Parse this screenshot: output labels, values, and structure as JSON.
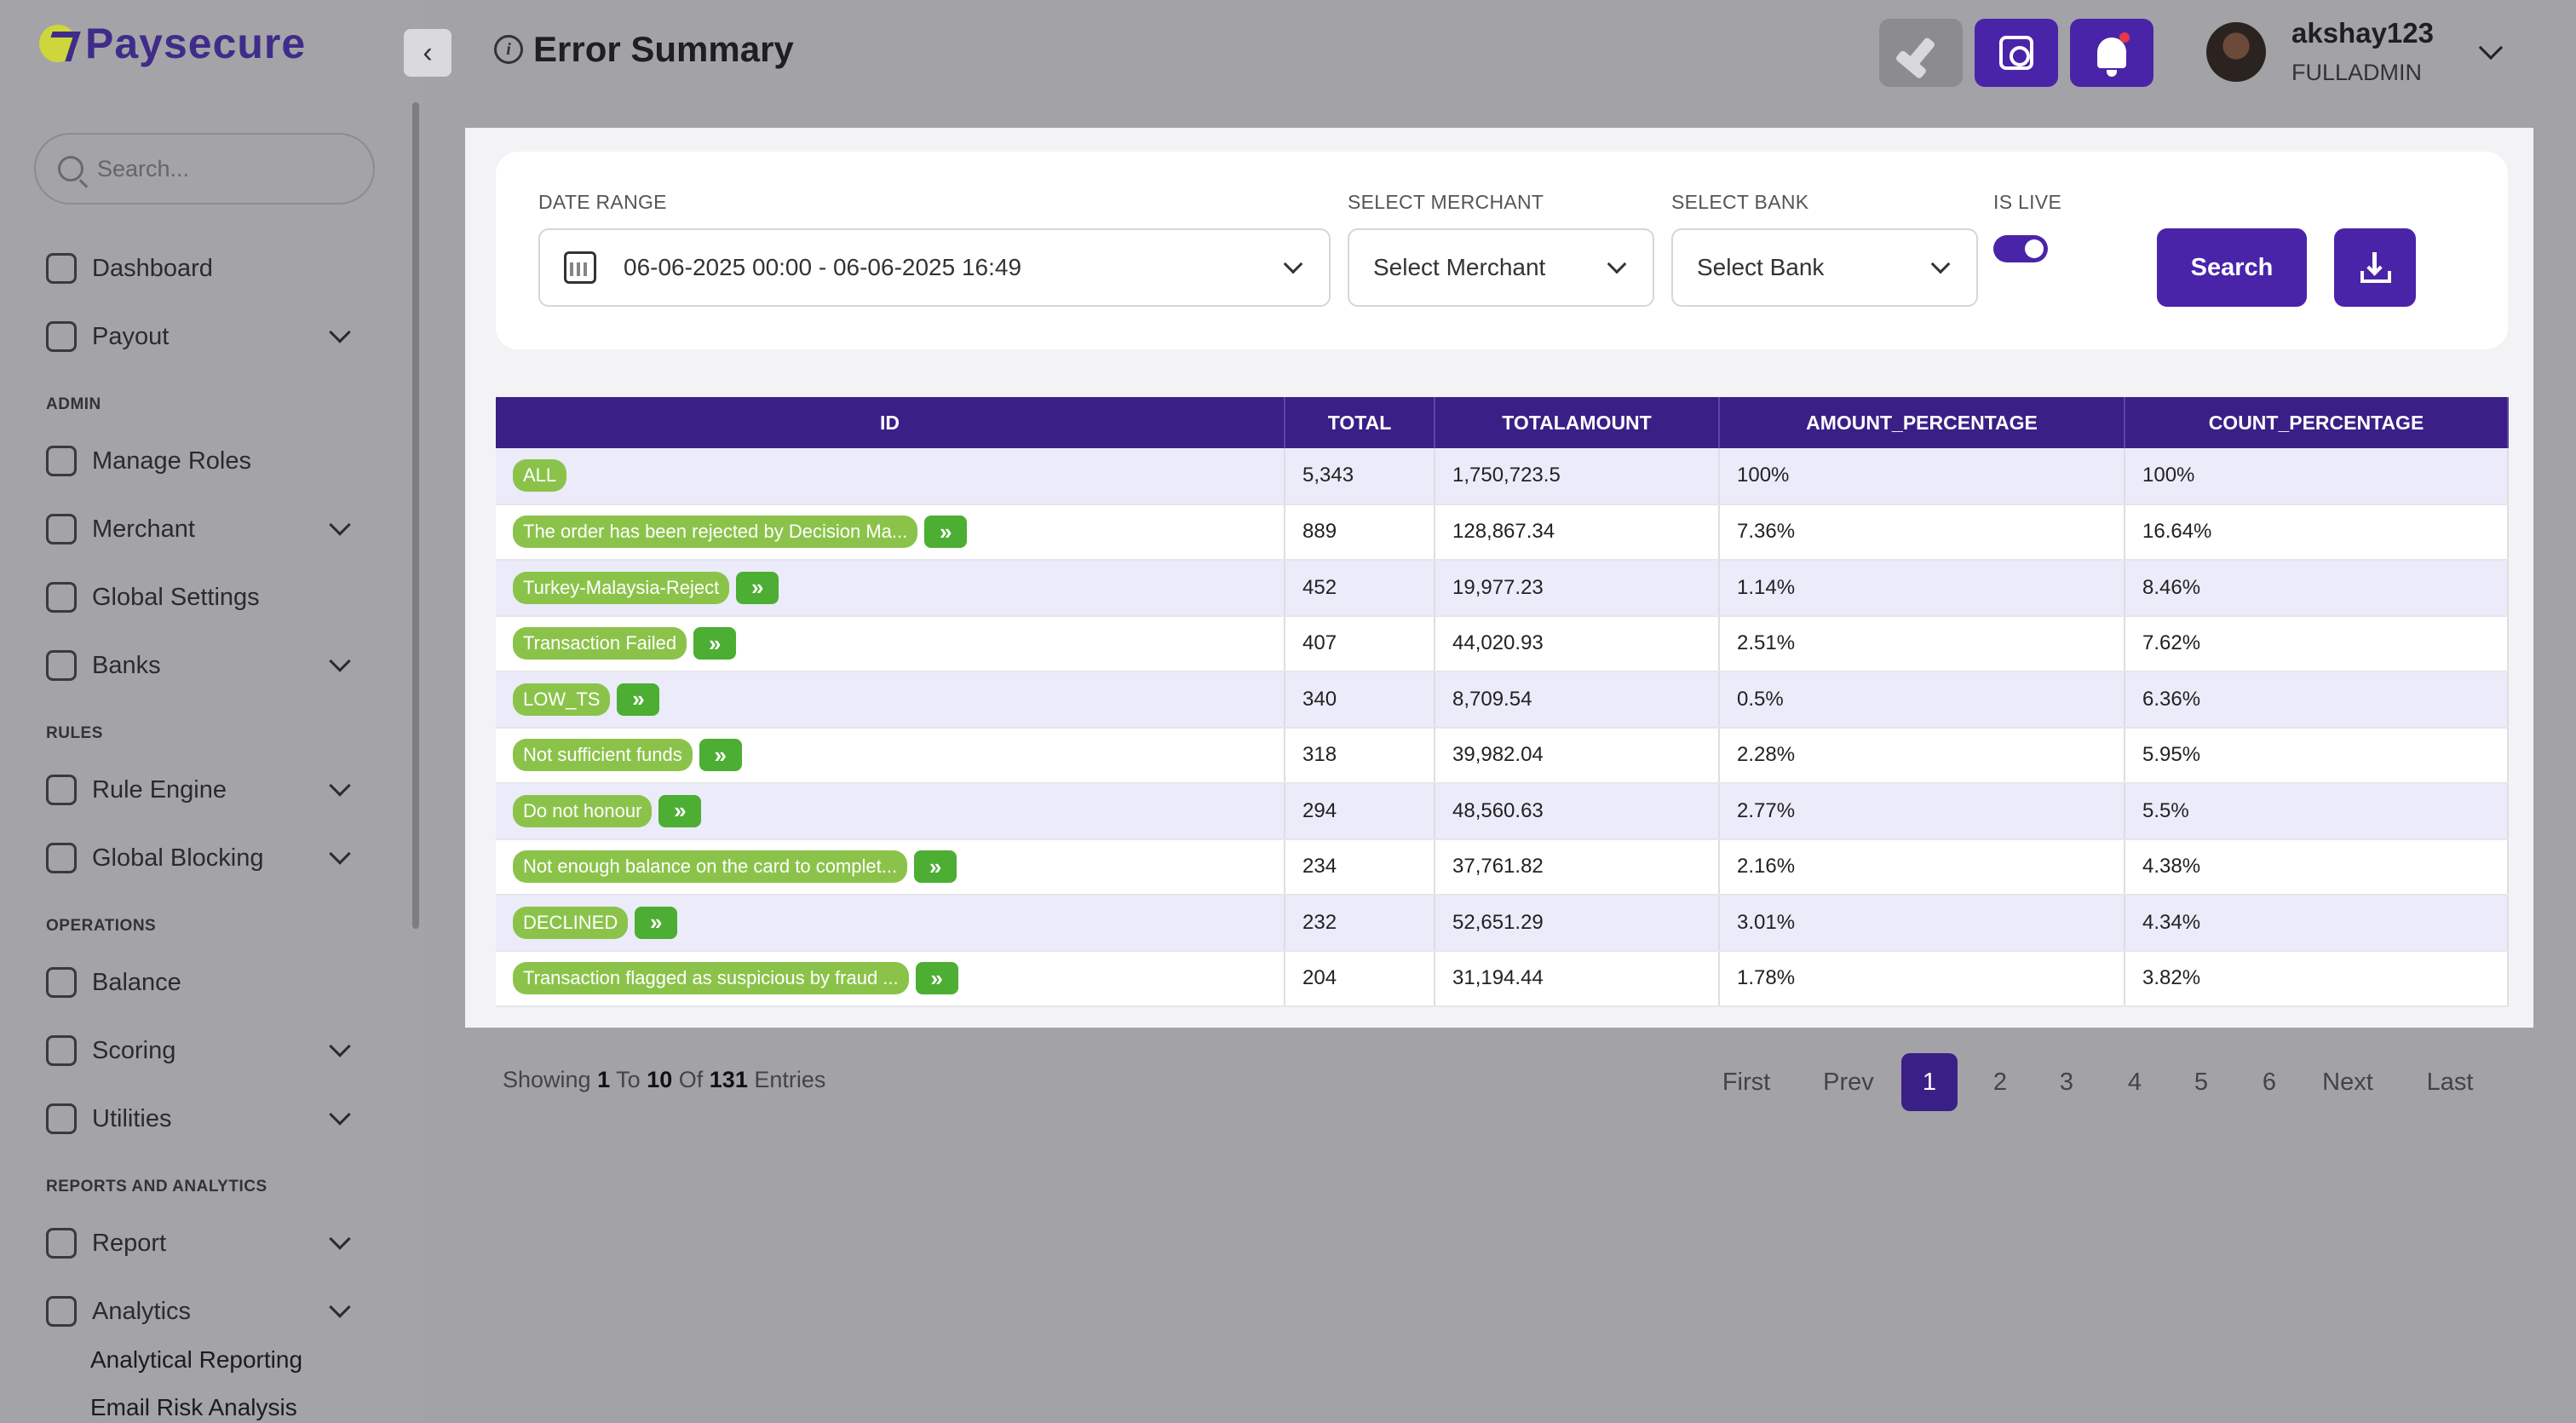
{
  "brand": {
    "name": "Paysecure"
  },
  "sidebar": {
    "search_placeholder": "Search...",
    "sections": {
      "admin": "ADMIN",
      "rules": "RULES",
      "operations": "OPERATIONS",
      "reports": "REPORTS AND ANALYTICS"
    },
    "items": {
      "dashboard": "Dashboard",
      "payout": "Payout",
      "manage_roles": "Manage Roles",
      "merchant": "Merchant",
      "global_settings": "Global Settings",
      "banks": "Banks",
      "rule_engine": "Rule Engine",
      "global_blocking": "Global Blocking",
      "balance": "Balance",
      "scoring": "Scoring",
      "utilities": "Utilities",
      "report": "Report",
      "analytics": "Analytics"
    },
    "sub_items": {
      "analytical_reporting": "Analytical Reporting",
      "email_risk_analysis": "Email Risk Analysis"
    }
  },
  "header": {
    "title": "Error Summary",
    "user_name": "akshay123",
    "user_role": "FULLADMIN"
  },
  "filters": {
    "date_range_label": "DATE RANGE",
    "date_range_value": "06-06-2025 00:00 - 06-06-2025 16:49",
    "merchant_label": "SELECT MERCHANT",
    "merchant_value": "Select Merchant",
    "bank_label": "SELECT BANK",
    "bank_value": "Select Bank",
    "is_live_label": "IS LIVE",
    "is_live": true,
    "search_label": "Search"
  },
  "table": {
    "columns": [
      "ID",
      "TOTAL",
      "TOTALAMOUNT",
      "AMOUNT_PERCENTAGE",
      "COUNT_PERCENTAGE"
    ],
    "rows": [
      {
        "id": "ALL",
        "total": "5,343",
        "amount": "1,750,723.5",
        "amount_pct": "100%",
        "count_pct": "100%"
      },
      {
        "id": "The order has been rejected by Decision Ma...",
        "total": "889",
        "amount": "128,867.34",
        "amount_pct": "7.36%",
        "count_pct": "16.64%"
      },
      {
        "id": "Turkey-Malaysia-Reject",
        "total": "452",
        "amount": "19,977.23",
        "amount_pct": "1.14%",
        "count_pct": "8.46%"
      },
      {
        "id": "Transaction Failed",
        "total": "407",
        "amount": "44,020.93",
        "amount_pct": "2.51%",
        "count_pct": "7.62%"
      },
      {
        "id": "LOW_TS",
        "total": "340",
        "amount": "8,709.54",
        "amount_pct": "0.5%",
        "count_pct": "6.36%"
      },
      {
        "id": "Not sufficient funds",
        "total": "318",
        "amount": "39,982.04",
        "amount_pct": "2.28%",
        "count_pct": "5.95%"
      },
      {
        "id": "Do not honour",
        "total": "294",
        "amount": "48,560.63",
        "amount_pct": "2.77%",
        "count_pct": "5.5%"
      },
      {
        "id": "Not enough balance on the card to complet...",
        "total": "234",
        "amount": "37,761.82",
        "amount_pct": "2.16%",
        "count_pct": "4.38%"
      },
      {
        "id": "DECLINED",
        "total": "232",
        "amount": "52,651.29",
        "amount_pct": "3.01%",
        "count_pct": "4.34%"
      },
      {
        "id": "Transaction flagged as suspicious by fraud ...",
        "total": "204",
        "amount": "31,194.44",
        "amount_pct": "1.78%",
        "count_pct": "3.82%"
      }
    ]
  },
  "footer": {
    "showing": "Showing",
    "from": "1",
    "to_word": "To",
    "to": "10",
    "of_word": "Of",
    "total": "131",
    "entries_word": "Entries"
  },
  "pagination": {
    "first": "First",
    "prev": "Prev",
    "pages": [
      "1",
      "2",
      "3",
      "4",
      "5",
      "6"
    ],
    "next": "Next",
    "last": "Last",
    "current": "1"
  },
  "colors": {
    "brand_purple": "#4a24a8",
    "table_header": "#3a1f86",
    "pill_green": "#8bc34a",
    "arrow_green": "#4cae32"
  }
}
